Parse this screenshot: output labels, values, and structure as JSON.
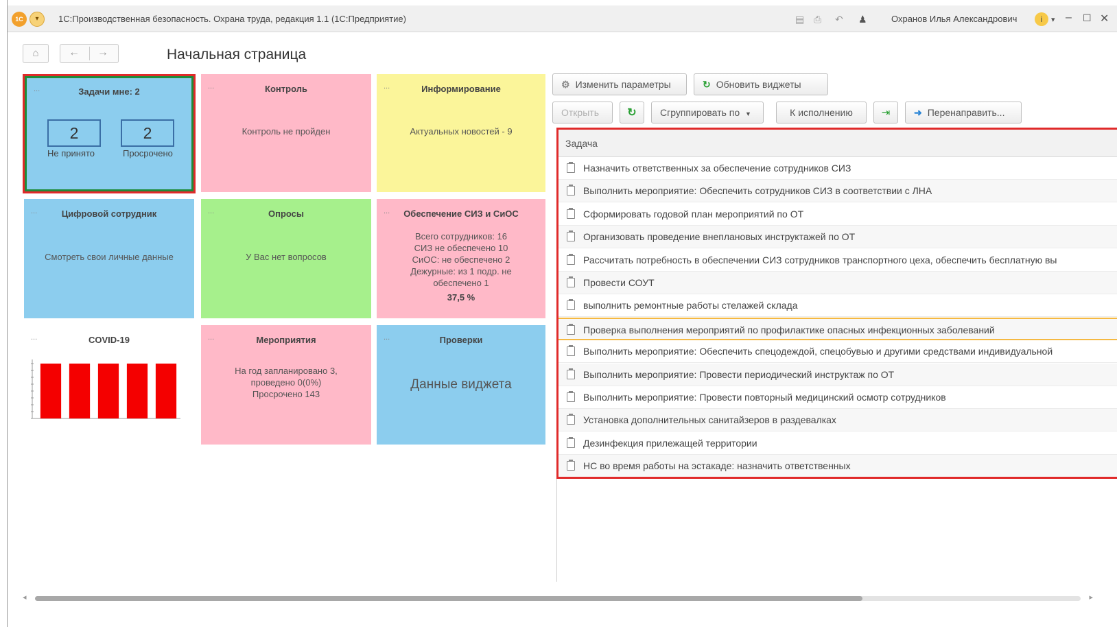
{
  "window": {
    "app_title": "1С:Производственная безопасность. Охрана труда, редакция 1.1  (1С:Предприятие)",
    "logo_text": "1С",
    "user": "Охранов Илья Александрович",
    "info": "i"
  },
  "nav": {
    "page_title": "Начальная страница"
  },
  "widgets": {
    "tasks": {
      "title": "Задачи мне: 2",
      "not_accepted_count": "2",
      "not_accepted_label": "Не принято",
      "overdue_count": "2",
      "overdue_label": "Просрочено"
    },
    "control": {
      "title": "Контроль",
      "text": "Контроль не пройден"
    },
    "informing": {
      "title": "Информирование",
      "text": "Актуальных новостей - 9"
    },
    "digital_employee": {
      "title": "Цифровой сотрудник",
      "text": "Смотреть свои личные данные"
    },
    "surveys": {
      "title": "Опросы",
      "text": "У Вас нет вопросов"
    },
    "ppe": {
      "title": "Обеспечение СИЗ и СиОС",
      "line1": "Всего сотрудников: 16",
      "line2": "СИЗ не обеспечено 10",
      "line3": "СиОС: не обеспечено 2",
      "line4": "Дежурные: из 1 подр. не",
      "line5": "обеспечено 1",
      "percent": "37,5 %"
    },
    "covid": {
      "title": "COVID-19"
    },
    "events": {
      "title": "Мероприятия",
      "line1": "На год запланировано 3,",
      "line2": "проведено 0(0%)",
      "line3": "Просрочено 143"
    },
    "checks": {
      "title": "Проверки",
      "text": "Данные виджета"
    },
    "dots": "..."
  },
  "chart_data": {
    "type": "bar",
    "title": "COVID-19",
    "categories": [
      "",
      "",
      "",
      "",
      ""
    ],
    "values": [
      1,
      1,
      1,
      1,
      1
    ],
    "ylim": [
      0,
      1
    ],
    "colors": [
      "#f40000"
    ]
  },
  "toolbar": {
    "change_params": "Изменить параметры",
    "refresh_widgets": "Обновить виджеты",
    "open": "Открыть",
    "group_by": "Сгруппировать по",
    "to_execution": "К исполнению",
    "redirect": "Перенаправить..."
  },
  "task_list": {
    "header": "Задача",
    "rows": [
      "Назначить ответственных за обеспечение сотрудников СИЗ",
      "Выполнить мероприятие: Обеспечить сотрудников СИЗ в соответствии с ЛНА",
      "Сформировать годовой план мероприятий по ОТ",
      "Организовать проведение внеплановых инструктажей по ОТ",
      "Рассчитать потребность в обеспечении СИЗ сотрудников транспортного цеха, обеспечить бесплатную вы",
      "Провести СОУТ",
      "выполнить ремонтные работы стелажей склада",
      "Проверка выполнения мероприятий по профилактике опасных инфекционных заболеваний",
      "Выполнить мероприятие: Обеспечить спецодеждой, спецобувью и другими средствами индивидуальной",
      "Выполнить мероприятие: Провести периодический инструктаж по ОТ",
      "Выполнить мероприятие: Провести повторный медицинский осмотр сотрудников",
      "Установка дополнительных санитайзеров в раздевалках",
      "Дезинфекция прилежащей территории",
      "НС во время работы на эстакаде: назначить ответственных"
    ]
  },
  "colors": {
    "widget_blue": "#8ccdee",
    "widget_pink": "#ffb9c8",
    "widget_yellow": "#fbf59a",
    "widget_green": "#a6f08c",
    "highlight_red": "#e02a2a",
    "selected_row": "#f5b942"
  }
}
